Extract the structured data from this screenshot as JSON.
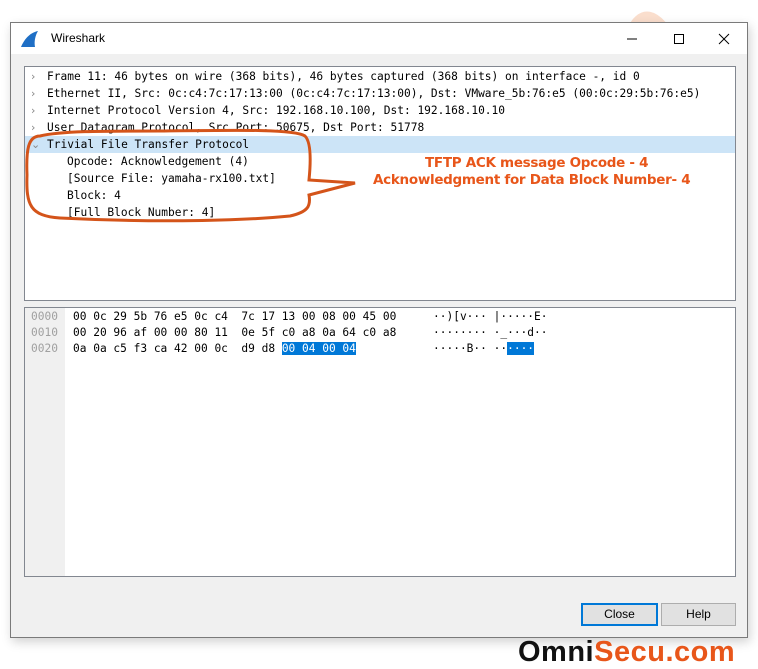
{
  "window": {
    "title": "Wireshark",
    "icon": "wireshark-fin-icon",
    "controls": {
      "minimize": "minimize-icon",
      "maximize": "maximize-icon",
      "close": "close-icon"
    }
  },
  "details": {
    "rows": [
      {
        "expanded": false,
        "text": "Frame 11: 46 bytes on wire (368 bits), 46 bytes captured (368 bits) on interface -, id 0"
      },
      {
        "expanded": false,
        "text": "Ethernet II, Src: 0c:c4:7c:17:13:00 (0c:c4:7c:17:13:00), Dst: VMware_5b:76:e5 (00:0c:29:5b:76:e5)"
      },
      {
        "expanded": false,
        "text": "Internet Protocol Version 4, Src: 192.168.10.100, Dst: 192.168.10.10"
      },
      {
        "expanded": false,
        "text": "User Datagram Protocol, Src Port: 50675, Dst Port: 51778"
      },
      {
        "expanded": true,
        "selected": true,
        "text": "Trivial File Transfer Protocol"
      }
    ],
    "children": [
      "Opcode: Acknowledgement (4)",
      "[Source File: yamaha-rx100.txt]",
      "Block: 4",
      "[Full Block Number: 4]"
    ]
  },
  "hex": {
    "rows": [
      {
        "offset": "0000",
        "bytes": "00 0c 29 5b 76 e5 0c c4  7c 17 13 00 08 00 45 00",
        "highlight": "",
        "ascii": "··)[v··· |·····E·"
      },
      {
        "offset": "0010",
        "bytes": "00 20 96 af 00 00 80 11  0e 5f c0 a8 0a 64 c0 a8",
        "highlight": "",
        "ascii": "········ ·_···d··"
      },
      {
        "offset": "0020",
        "bytes": "0a 0a c5 f3 ca 42 00 0c  d9 d8 ",
        "highlight": "00 04 00 04",
        "ascii": "·····B·· ··",
        "ascii_highlight": "····"
      }
    ]
  },
  "buttons": {
    "close": "Close",
    "help": "Help"
  },
  "annotation": {
    "line1": "TFTP ACK message Opcode - 4",
    "line2": "Acknowledgment for Data Block Number- 4",
    "color": "#e8561a"
  },
  "watermark": {
    "text": "OmniSecu.com"
  },
  "logo": {
    "part1": "Omni",
    "part2": "Secu.com"
  }
}
